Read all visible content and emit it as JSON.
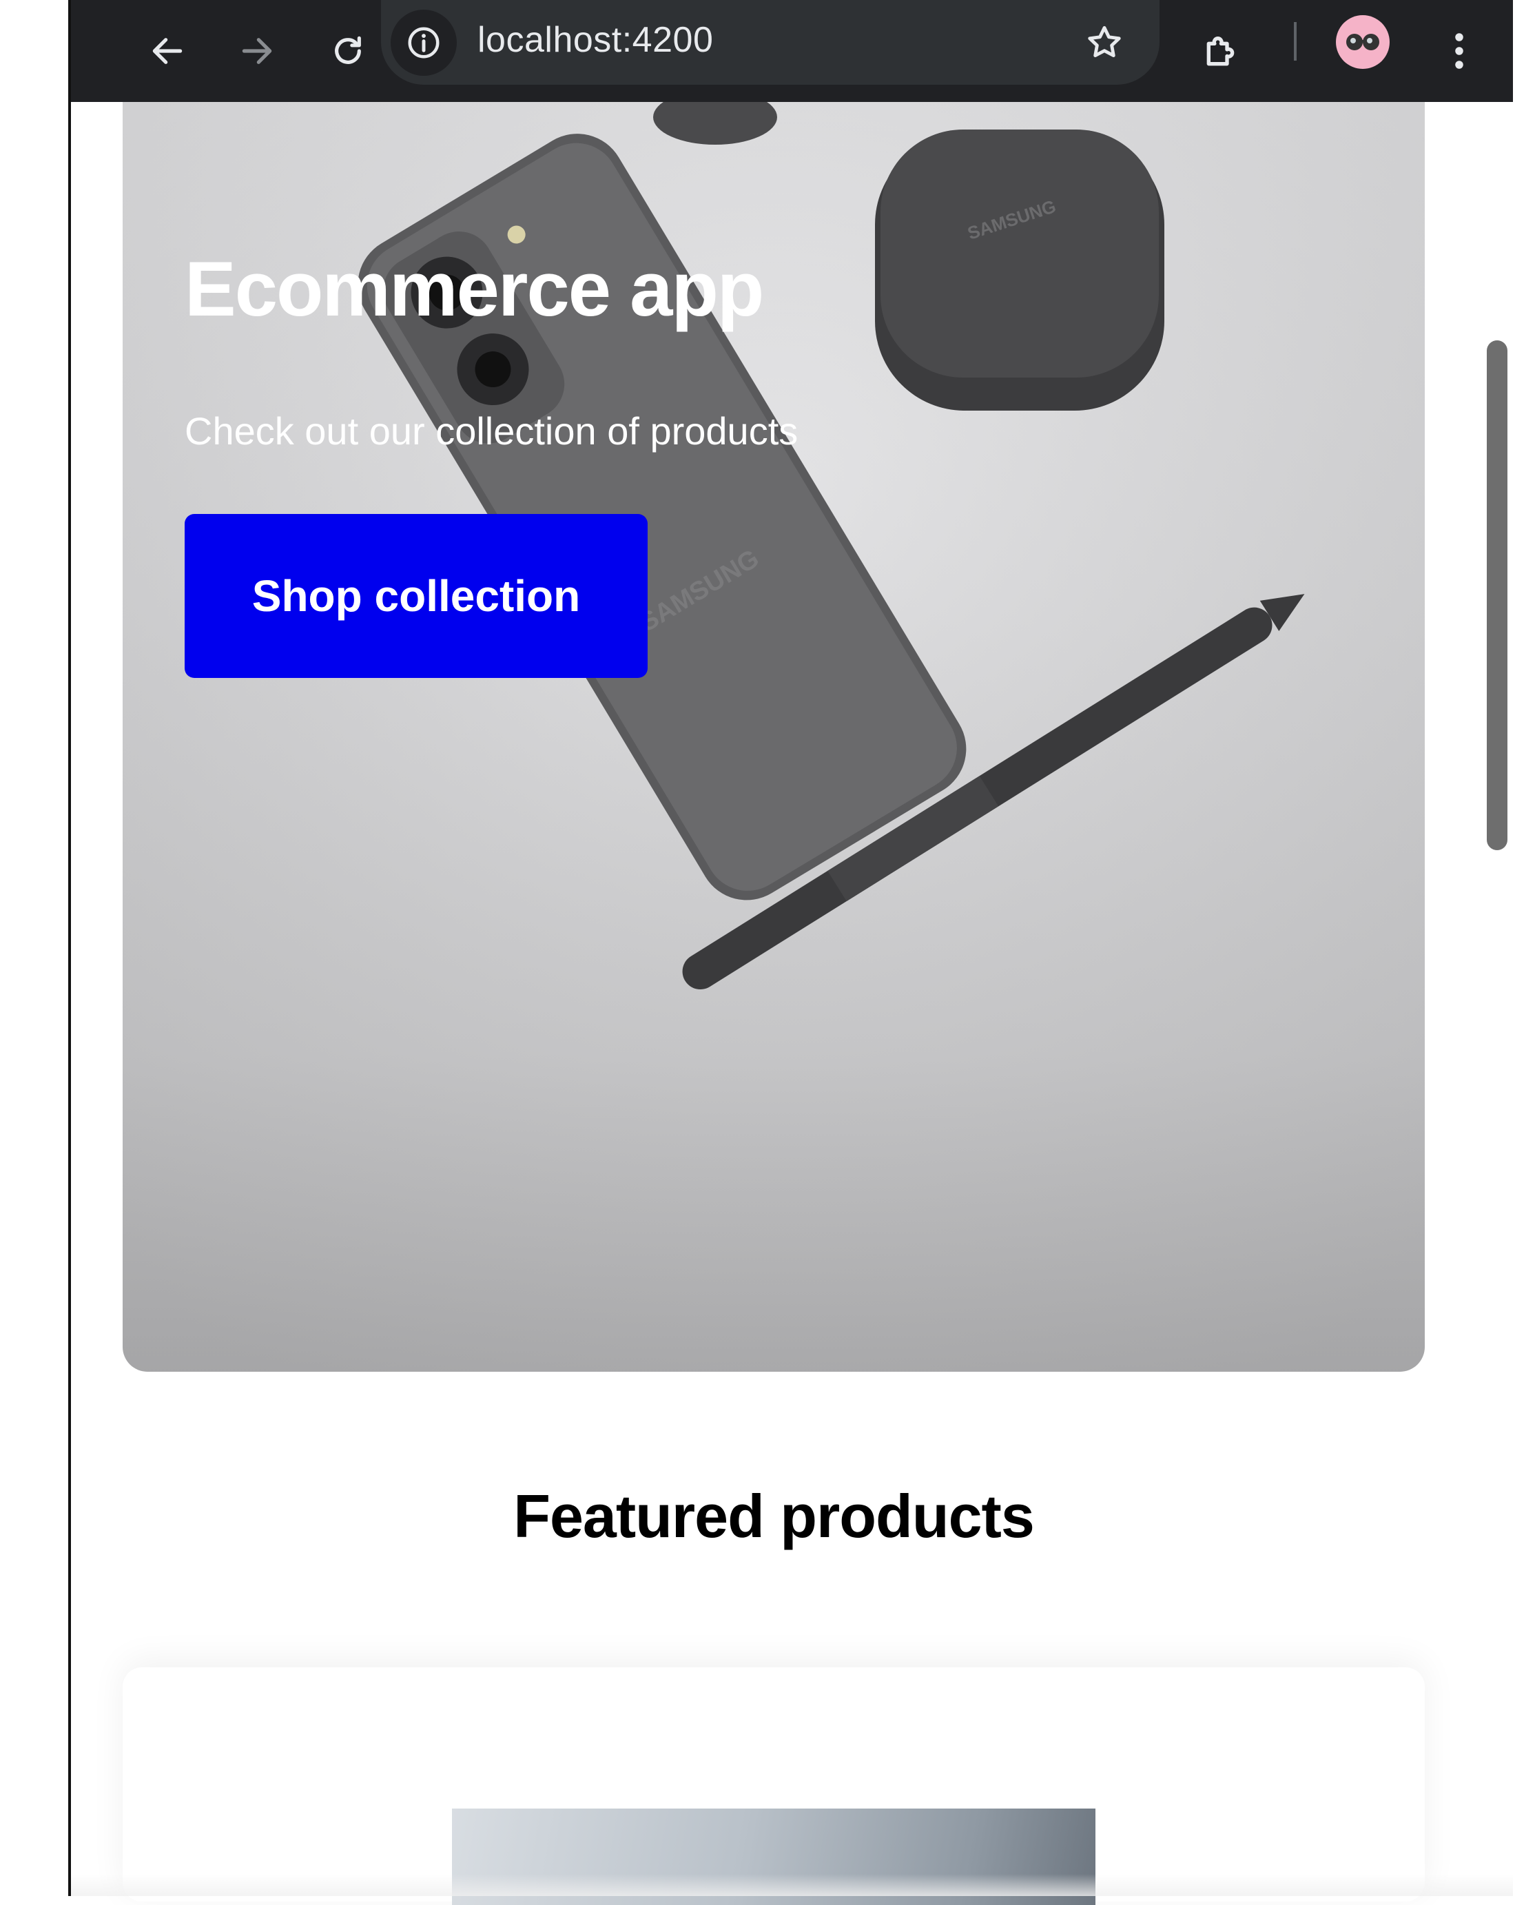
{
  "browser": {
    "url": "localhost:4200",
    "icons": {
      "back": "arrow-left-icon",
      "forward": "arrow-right-icon",
      "reload": "reload-icon",
      "site_info": "info-icon",
      "bookmark": "star-icon",
      "extensions": "puzzle-icon",
      "profile": "avatar-icon",
      "menu": "kebab-menu-icon"
    }
  },
  "hero": {
    "title": "Ecommerce app",
    "subtitle": "Check out our collection of products",
    "cta_label": "Shop collection",
    "cta_color": "#0000EE"
  },
  "featured": {
    "title": "Featured products"
  }
}
